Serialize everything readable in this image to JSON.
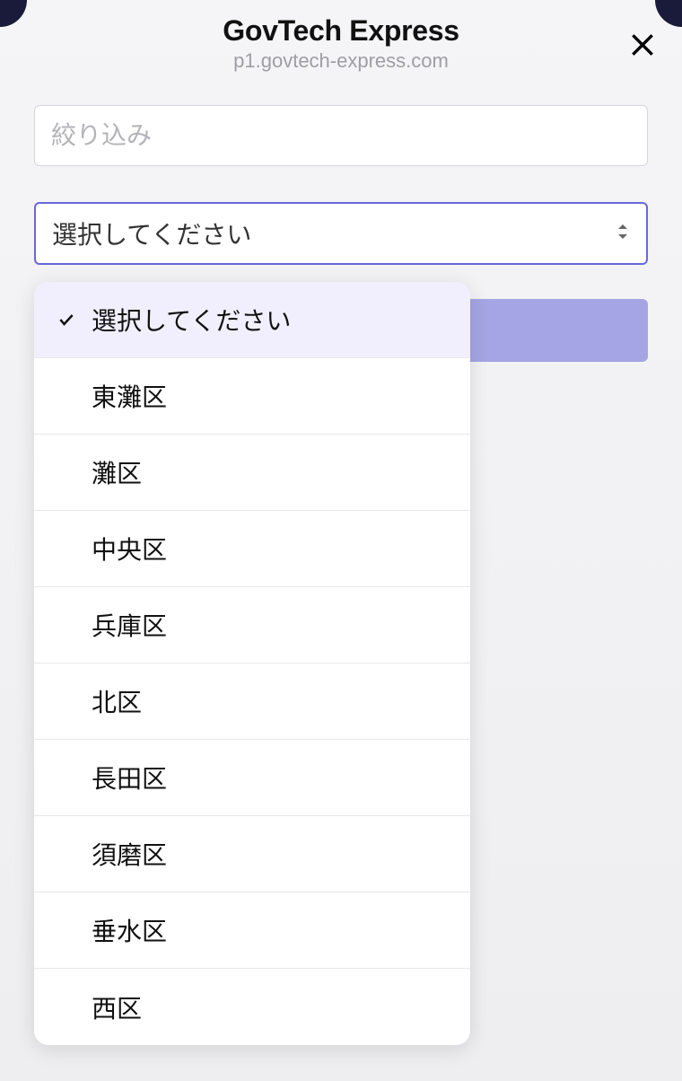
{
  "header": {
    "title": "GovTech Express",
    "subtitle": "p1.govtech-express.com"
  },
  "filter": {
    "placeholder": "絞り込み"
  },
  "select": {
    "placeholder": "選択してください"
  },
  "dropdown": {
    "options": [
      {
        "label": "選択してください",
        "selected": true
      },
      {
        "label": "東灘区",
        "selected": false
      },
      {
        "label": "灘区",
        "selected": false
      },
      {
        "label": "中央区",
        "selected": false
      },
      {
        "label": "兵庫区",
        "selected": false
      },
      {
        "label": "北区",
        "selected": false
      },
      {
        "label": "長田区",
        "selected": false
      },
      {
        "label": "須磨区",
        "selected": false
      },
      {
        "label": "垂水区",
        "selected": false
      },
      {
        "label": "西区",
        "selected": false
      }
    ]
  }
}
